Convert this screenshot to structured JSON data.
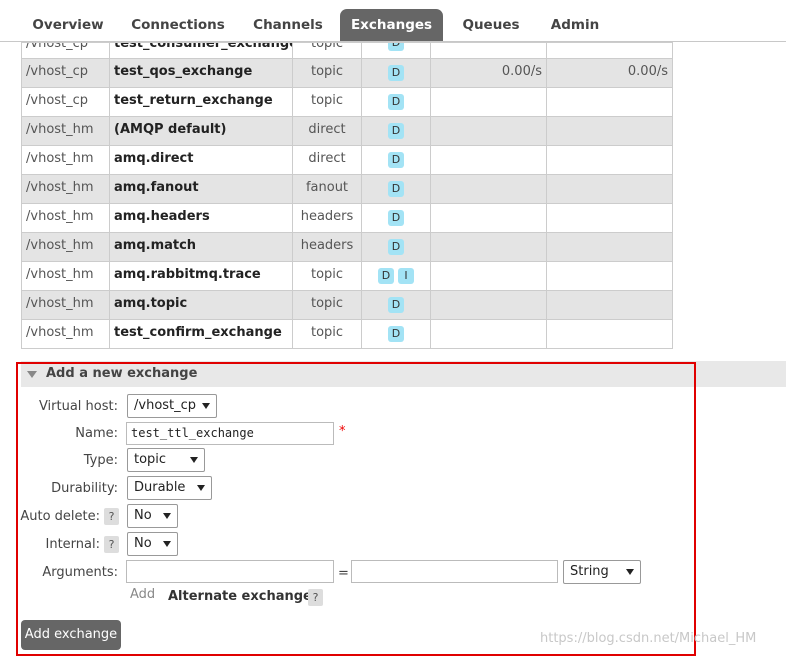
{
  "nav": {
    "tabs": [
      {
        "label": "Overview"
      },
      {
        "label": "Connections"
      },
      {
        "label": "Channels"
      },
      {
        "label": "Exchanges"
      },
      {
        "label": "Queues"
      },
      {
        "label": "Admin"
      }
    ],
    "active": "Exchanges"
  },
  "exchanges": {
    "rows": [
      {
        "vhost": "/vhost_cp",
        "name": "test_consumer_exchange",
        "type": "topic",
        "features": [
          "D"
        ],
        "rate_in": "",
        "rate_out": ""
      },
      {
        "vhost": "/vhost_cp",
        "name": "test_qos_exchange",
        "type": "topic",
        "features": [
          "D"
        ],
        "rate_in": "0.00/s",
        "rate_out": "0.00/s"
      },
      {
        "vhost": "/vhost_cp",
        "name": "test_return_exchange",
        "type": "topic",
        "features": [
          "D"
        ],
        "rate_in": "",
        "rate_out": ""
      },
      {
        "vhost": "/vhost_hm",
        "name": "(AMQP default)",
        "type": "direct",
        "features": [
          "D"
        ],
        "rate_in": "",
        "rate_out": ""
      },
      {
        "vhost": "/vhost_hm",
        "name": "amq.direct",
        "type": "direct",
        "features": [
          "D"
        ],
        "rate_in": "",
        "rate_out": ""
      },
      {
        "vhost": "/vhost_hm",
        "name": "amq.fanout",
        "type": "fanout",
        "features": [
          "D"
        ],
        "rate_in": "",
        "rate_out": ""
      },
      {
        "vhost": "/vhost_hm",
        "name": "amq.headers",
        "type": "headers",
        "features": [
          "D"
        ],
        "rate_in": "",
        "rate_out": ""
      },
      {
        "vhost": "/vhost_hm",
        "name": "amq.match",
        "type": "headers",
        "features": [
          "D"
        ],
        "rate_in": "",
        "rate_out": ""
      },
      {
        "vhost": "/vhost_hm",
        "name": "amq.rabbitmq.trace",
        "type": "topic",
        "features": [
          "D",
          "I"
        ],
        "rate_in": "",
        "rate_out": ""
      },
      {
        "vhost": "/vhost_hm",
        "name": "amq.topic",
        "type": "topic",
        "features": [
          "D"
        ],
        "rate_in": "",
        "rate_out": ""
      },
      {
        "vhost": "/vhost_hm",
        "name": "test_confirm_exchange",
        "type": "topic",
        "features": [
          "D"
        ],
        "rate_in": "",
        "rate_out": ""
      }
    ]
  },
  "add_exchange": {
    "title": "Add a new exchange",
    "virtual_host": {
      "label": "Virtual host:",
      "value": "/vhost_cp"
    },
    "name": {
      "label": "Name:",
      "value": "test_ttl_exchange",
      "required_mark": "*"
    },
    "type": {
      "label": "Type:",
      "value": "topic"
    },
    "durability": {
      "label": "Durability:",
      "value": "Durable"
    },
    "auto_delete": {
      "label": "Auto delete:",
      "help": "?",
      "value": "No"
    },
    "internal": {
      "label": "Internal:",
      "help": "?",
      "value": "No"
    },
    "arguments": {
      "label": "Arguments:",
      "key": "",
      "equals": "=",
      "value": "",
      "value_type": "String"
    },
    "add_link": "Add",
    "alternate_exchange": "Alternate exchange",
    "alternate_help": "?",
    "submit": "Add exchange"
  },
  "watermark": "https://blog.csdn.net/Michael_HM"
}
